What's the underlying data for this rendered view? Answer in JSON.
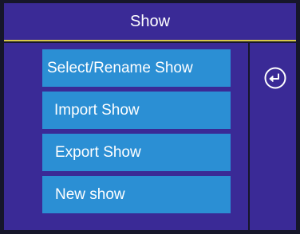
{
  "title": "Show",
  "menu": {
    "items": [
      {
        "label": "Select/Rename Show"
      },
      {
        "label": "Import Show"
      },
      {
        "label": "Export Show"
      },
      {
        "label": "New show"
      }
    ]
  },
  "side": {
    "back_icon": "enter-arrow-circle-icon"
  },
  "colors": {
    "background": "#16162a",
    "panel": "#3a2a96",
    "button": "#2b8fd4",
    "title_underline": "#d9c84a",
    "text": "#ffffff"
  }
}
